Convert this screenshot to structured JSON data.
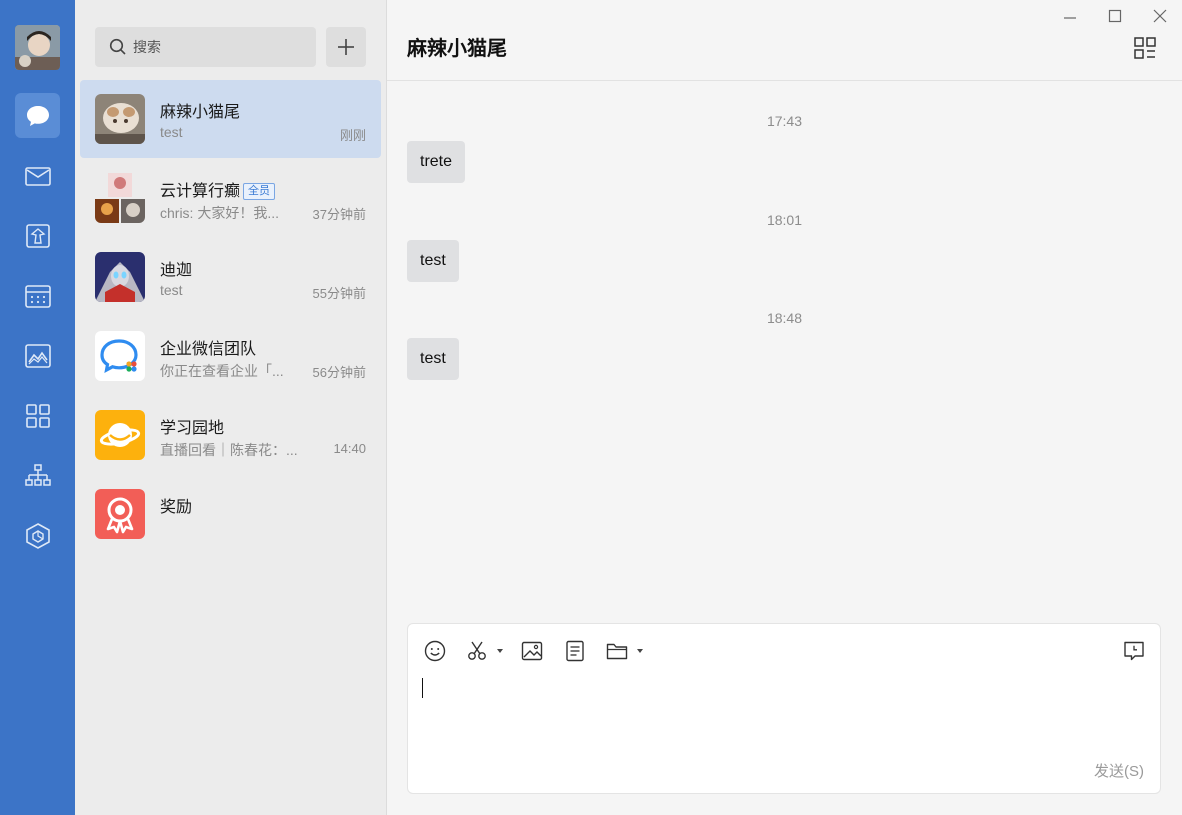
{
  "window": {
    "controls": [
      "minimize",
      "maximize",
      "close"
    ]
  },
  "rail": {
    "avatar_icon": "user-avatar",
    "items": [
      {
        "icon": "chat-bubble-icon",
        "active": true
      },
      {
        "icon": "mail-icon",
        "active": false
      },
      {
        "icon": "docs-icon",
        "active": false
      },
      {
        "icon": "calendar-icon",
        "active": false
      },
      {
        "icon": "meeting-icon",
        "active": false
      },
      {
        "icon": "workbench-icon",
        "active": false
      },
      {
        "icon": "contacts-icon",
        "active": false
      },
      {
        "icon": "cube-icon",
        "active": false
      }
    ],
    "accent": "#3c74c7"
  },
  "search": {
    "placeholder": "搜索",
    "add_icon": "plus-icon"
  },
  "conversations": [
    {
      "name": "麻辣小猫尾",
      "preview": "test",
      "time": "刚刚",
      "active": true,
      "badge": ""
    },
    {
      "name": "云计算行癫",
      "preview": "chris: 大家好！我...",
      "time": "37分钟前",
      "active": false,
      "badge": "全员"
    },
    {
      "name": "迪迦",
      "preview": "test",
      "time": "55分钟前",
      "active": false,
      "badge": ""
    },
    {
      "name": "企业微信团队",
      "preview": "你正在查看企业「...",
      "time": "56分钟前",
      "active": false,
      "badge": ""
    },
    {
      "name": "学习园地",
      "preview": "直播回看｜陈春花：...",
      "time": "14:40",
      "active": false,
      "badge": ""
    },
    {
      "name": "奖励",
      "preview": "",
      "time": "",
      "active": false,
      "badge": ""
    }
  ],
  "chat": {
    "title": "麻辣小猫尾",
    "messages": [
      {
        "time": "17:43",
        "text": "trete"
      },
      {
        "time": "18:01",
        "text": "test"
      },
      {
        "time": "18:48",
        "text": "test"
      }
    ],
    "send_label": "发送(S)"
  },
  "toolbar": {
    "tools": [
      "emoji-icon",
      "scissors-icon",
      "image-icon",
      "note-icon",
      "folder-icon",
      "history-icon"
    ]
  }
}
